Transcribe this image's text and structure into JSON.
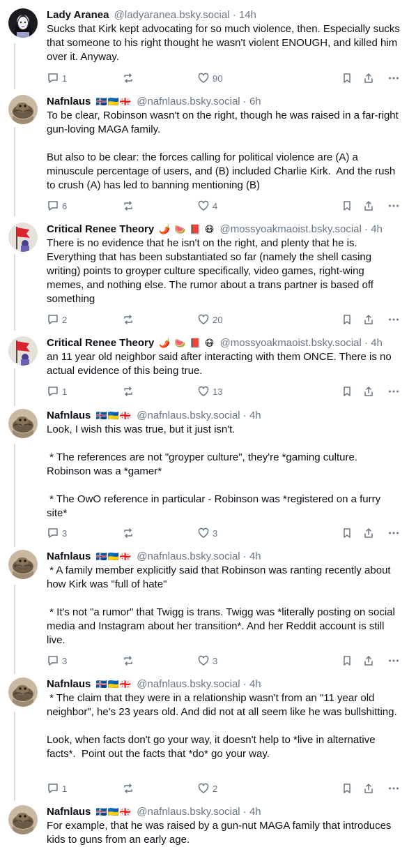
{
  "posts": [
    {
      "author": "Lady Aranea",
      "flags": "",
      "handle": "@ladyaranea.bsky.social",
      "time": "14h",
      "paragraphs": [
        "Sucks that Kirk kept advocating for so much violence, then. Especially sucks that someone to his right thought he wasn't violent ENOUGH, and killed him over it. Anyway."
      ],
      "replies": "1",
      "reposts": "",
      "likes": "90",
      "avatar_icon": "goth-portrait-avatar"
    },
    {
      "author": "Nafnlaus",
      "flags": "🇮🇸🇺🇦🇬🇪",
      "handle": "@nafnlaus.bsky.social",
      "time": "6h",
      "paragraphs": [
        "To be clear, Robinson wasn't on the right, though he was raised in a far-right gun-loving MAGA family.",
        "But also to be clear: the forces calling for political violence are (A) a minuscule percentage of users, and (B) included Charlie Kirk.  And the rush to crush (A) has led to banning mentioning (B)"
      ],
      "replies": "6",
      "reposts": "",
      "likes": "4",
      "avatar_icon": "lizard-avatar"
    },
    {
      "author": "Critical Renee Theory",
      "flags": "🌶️ 🍉 📕 😷",
      "handle": "@mossyoakmaoist.bsky.social",
      "time": "4h",
      "paragraphs": [
        "There is no evidence that he isn't on the right, and plenty that he is. Everything that has been substantiated so far (namely the shell casing writing) points to groyper culture specifically, video games, right-wing memes, and nothing else. The rumor about a trans partner is based off something"
      ],
      "replies": "2",
      "reposts": "",
      "likes": "20",
      "avatar_icon": "red-flag-avatar"
    },
    {
      "author": "Critical Renee Theory",
      "flags": "🌶️ 🍉 📕 😷",
      "handle": "@mossyoakmaoist.bsky.social",
      "time": "4h",
      "paragraphs": [
        "an 11 year old neighbor said after interacting with them ONCE. There is no actual evidence of this being true."
      ],
      "replies": "1",
      "reposts": "",
      "likes": "13",
      "avatar_icon": "red-flag-avatar"
    },
    {
      "author": "Nafnlaus",
      "flags": "🇮🇸🇺🇦🇬🇪",
      "handle": "@nafnlaus.bsky.social",
      "time": "4h",
      "paragraphs": [
        "Look, I wish this was true, but it just isn't.",
        " * The references are not \"groyper culture\", they're *gaming culture. Robinson was a *gamer*",
        " * The OwO reference in particular - Robinson was *registered on a furry site*"
      ],
      "replies": "3",
      "reposts": "",
      "likes": "3",
      "avatar_icon": "lizard-avatar"
    },
    {
      "author": "Nafnlaus",
      "flags": "🇮🇸🇺🇦🇬🇪",
      "handle": "@nafnlaus.bsky.social",
      "time": "4h",
      "paragraphs": [
        " * A family member explicitly said that Robinson was ranting recently about how Kirk was \"full of hate\"",
        " * It's not \"a rumor\" that Twigg is trans. Twigg was *literally posting on social media and Instagram about her transition*. And her Reddit account is still live."
      ],
      "replies": "3",
      "reposts": "",
      "likes": "3",
      "avatar_icon": "lizard-avatar"
    },
    {
      "author": "Nafnlaus",
      "flags": "🇮🇸🇺🇦🇬🇪",
      "handle": "@nafnlaus.bsky.social",
      "time": "4h",
      "paragraphs": [
        " * The claim that they were in a relationship wasn't from an \"11 year old neighbor\", he's 23 years old. And did not at all seem like he was bullshitting.",
        "Look, when facts don't go your way, it doesn't help to *live in alternative facts*.  Point out the facts that *do* go your way."
      ],
      "replies": "1",
      "reposts": "",
      "likes": "2",
      "avatar_icon": "lizard-avatar"
    },
    {
      "author": "Nafnlaus",
      "flags": "🇮🇸🇺🇦🇬🇪",
      "handle": "@nafnlaus.bsky.social",
      "time": "4h",
      "paragraphs": [
        "For example, that he was raised by a gun-nut MAGA family that introduces kids to guns from an early age."
      ],
      "replies": null,
      "reposts": null,
      "likes": null,
      "avatar_icon": "lizard-avatar"
    }
  ],
  "ui": {
    "dot": "·"
  },
  "colors": {
    "text": "#0b0f14",
    "muted": "#687684",
    "thread_line": "#d4dbe2"
  }
}
